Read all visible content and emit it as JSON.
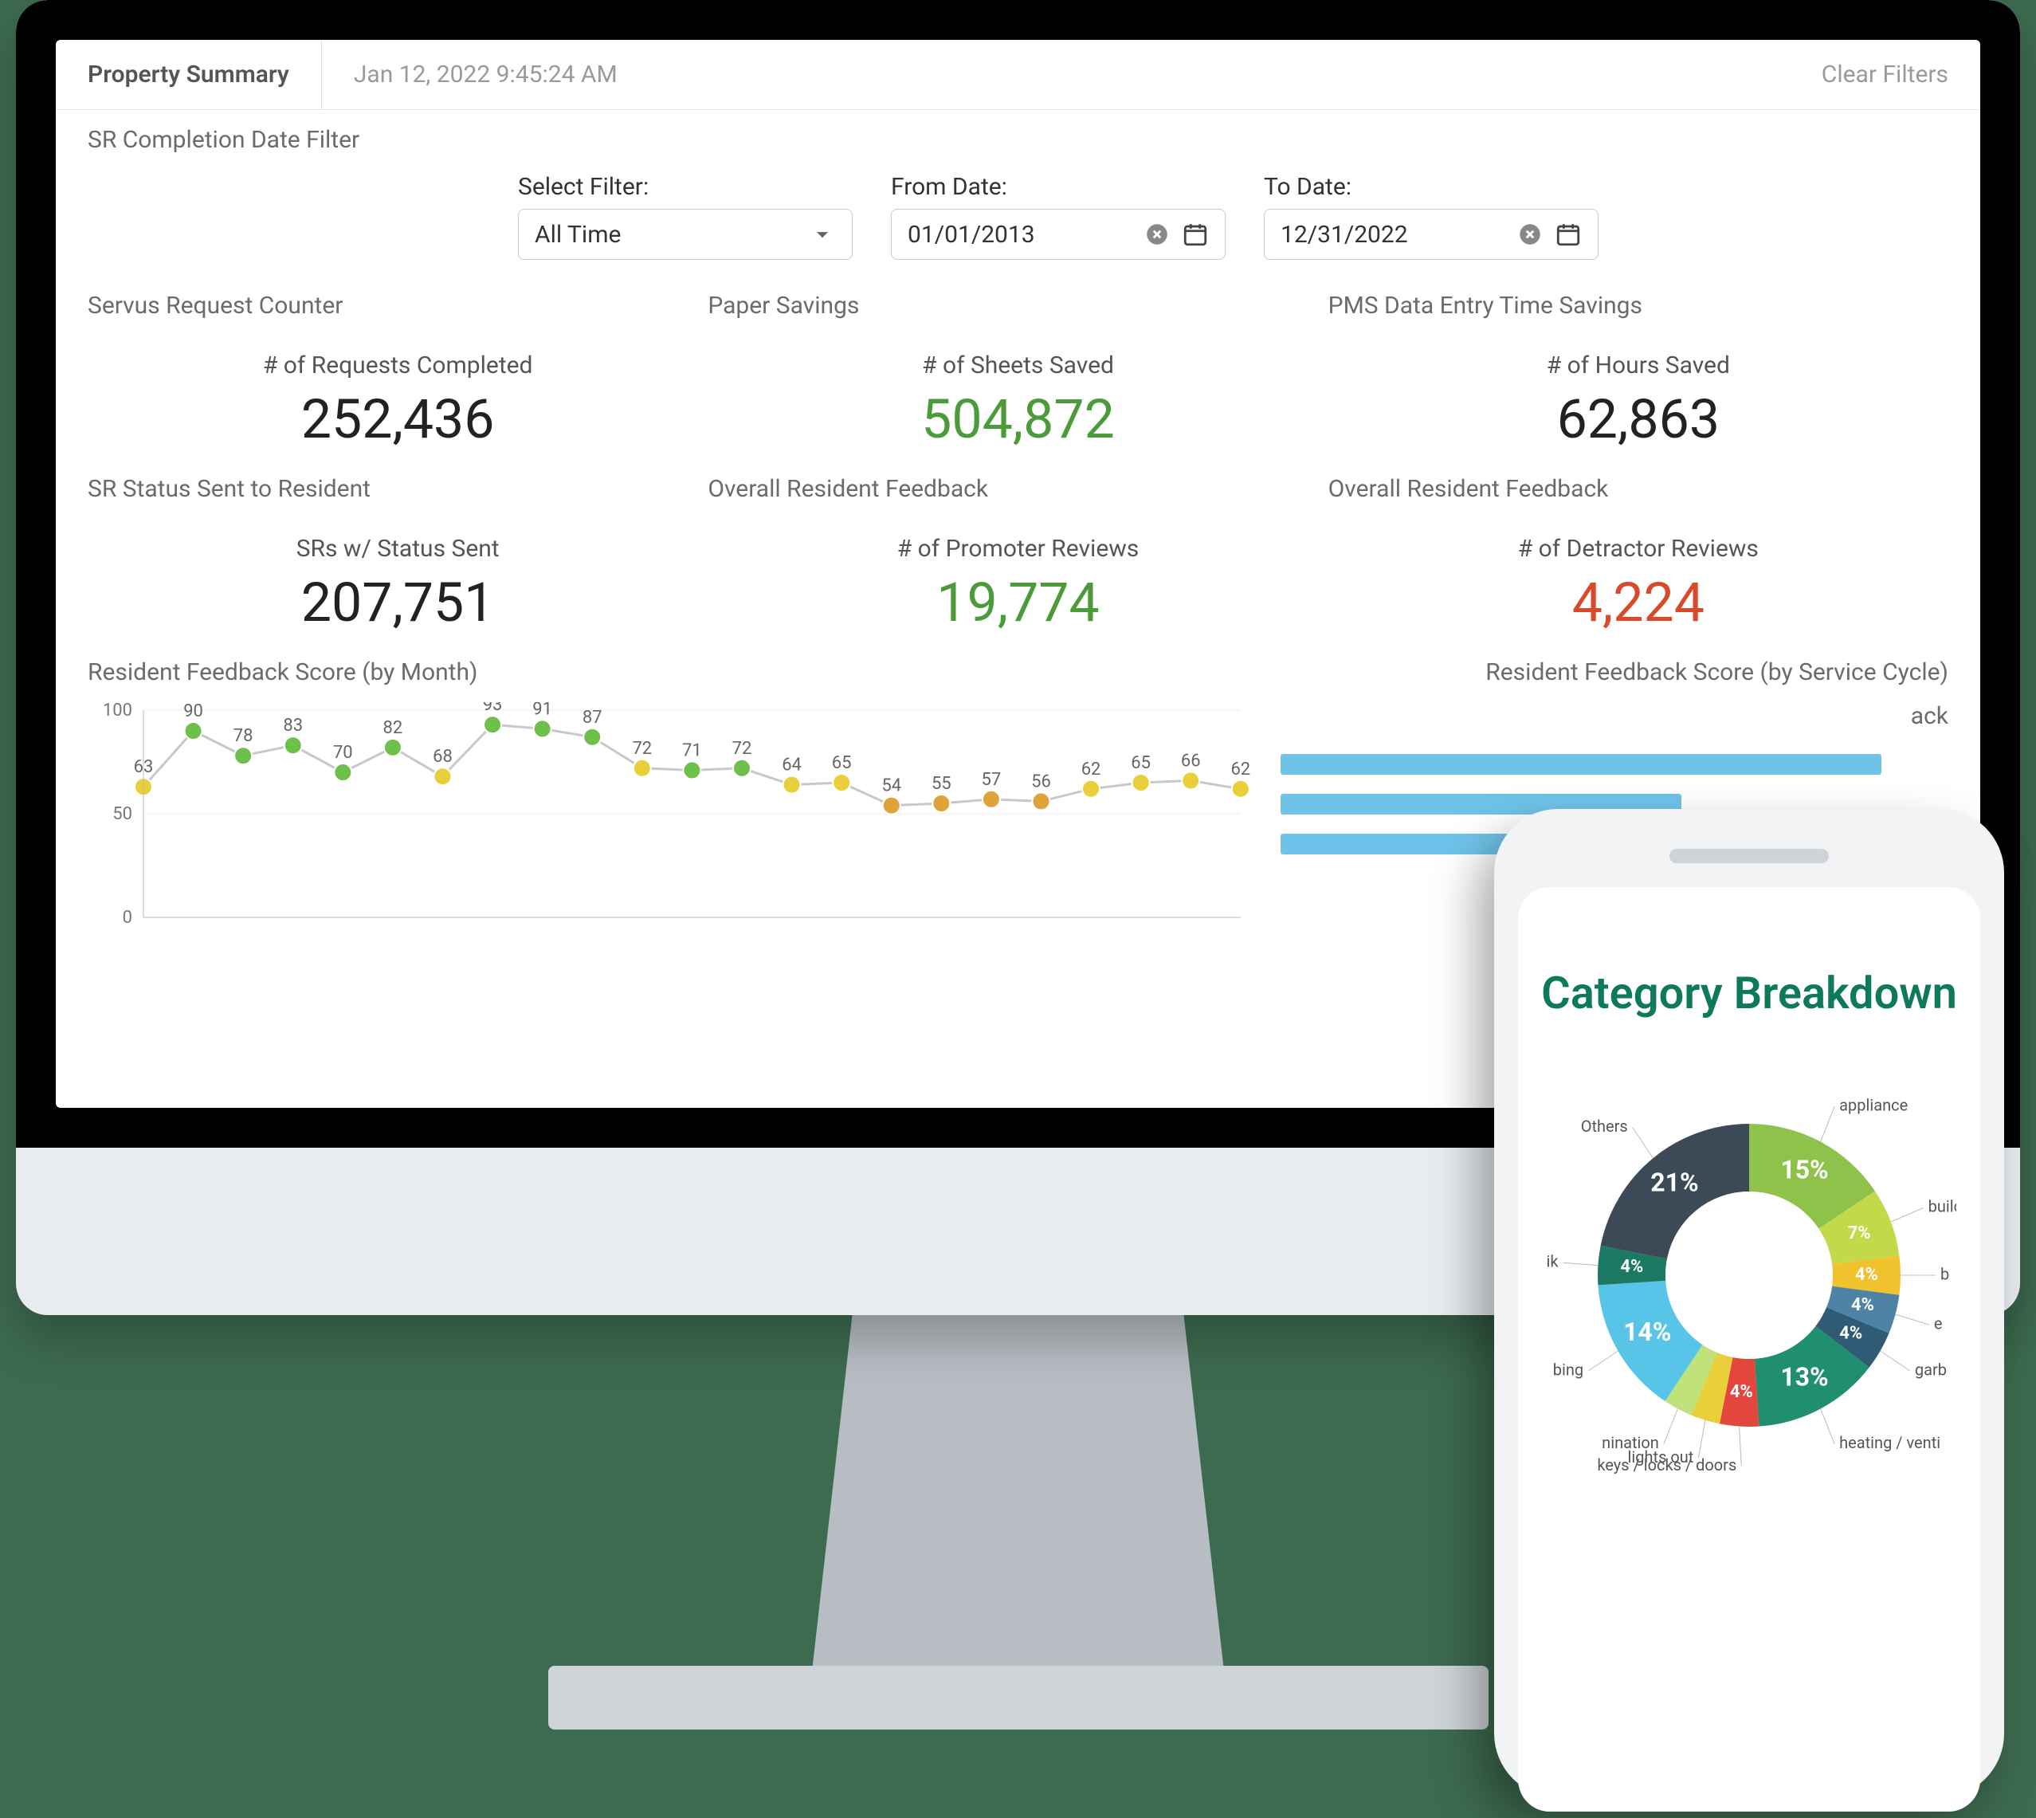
{
  "header": {
    "title": "Property Summary",
    "timestamp": "Jan 12, 2022 9:45:24 AM",
    "clear_filters": "Clear Filters"
  },
  "filter": {
    "section_label": "SR Completion Date Filter",
    "select_label": "Select Filter:",
    "select_value": "All Time",
    "from_label": "From Date:",
    "from_value": "01/01/2013",
    "to_label": "To Date:",
    "to_value": "12/31/2022"
  },
  "stats_top": {
    "col1": {
      "group": "Servus Request Counter",
      "sub": "# of Requests Completed",
      "value": "252,436"
    },
    "col2": {
      "group": "Paper Savings",
      "sub": "# of Sheets Saved",
      "value": "504,872"
    },
    "col3": {
      "group": "PMS Data Entry Time Savings",
      "sub": "# of Hours Saved",
      "value": "62,863"
    }
  },
  "stats_bottom": {
    "col1": {
      "group": "SR Status Sent to Resident",
      "sub": "SRs w/ Status Sent",
      "value": "207,751"
    },
    "col2": {
      "group": "Overall Resident Feedback",
      "sub": "# of Promoter Reviews",
      "value": "19,774"
    },
    "col3": {
      "group": "Overall Resident Feedback",
      "sub": "# of Detractor Reviews",
      "value": "4,224"
    }
  },
  "chart_left_title": "Resident Feedback Score (by Month)",
  "chart_right_title": "Resident Feedback Score (by Service Cycle)",
  "chart_right_partial": "ack",
  "phone": {
    "title": "Category Breakdown"
  },
  "chart_data": [
    {
      "type": "line",
      "title": "Resident Feedback Score (by Month)",
      "xlabel": "",
      "ylabel": "",
      "ylim": [
        0,
        100
      ],
      "y_ticks": [
        0,
        50,
        100
      ],
      "values": [
        63,
        90,
        78,
        83,
        70,
        82,
        68,
        93,
        91,
        87,
        72,
        71,
        72,
        64,
        65,
        54,
        55,
        57,
        56,
        62,
        65,
        66,
        62
      ],
      "point_colors": [
        "yellow",
        "green",
        "green",
        "green",
        "green",
        "green",
        "yellow",
        "green",
        "green",
        "green",
        "yellow",
        "green",
        "green",
        "yellow",
        "yellow",
        "orange",
        "orange",
        "orange",
        "orange",
        "yellow",
        "yellow",
        "yellow",
        "yellow"
      ]
    },
    {
      "type": "bar",
      "title": "Resident Feedback Score (by Service Cycle)",
      "categories": [],
      "values": [],
      "note": "Partially obscured by phone mockup; three light-blue bars visible."
    },
    {
      "type": "pie",
      "title": "Category Breakdown",
      "series": [
        {
          "name": "appliance",
          "value": 15
        },
        {
          "name": "build",
          "value": 7
        },
        {
          "name": "b",
          "value": 4
        },
        {
          "name": "e",
          "value": 4
        },
        {
          "name": "garb",
          "value": 4
        },
        {
          "name": "heating / venti",
          "value": 13
        },
        {
          "name": "keys / locks / doors",
          "value": 4
        },
        {
          "name": "lights out",
          "value": 3
        },
        {
          "name": "nination",
          "value": 3
        },
        {
          "name": "bing",
          "value": 14
        },
        {
          "name": "ik",
          "value": 4
        },
        {
          "name": "Others",
          "value": 21
        }
      ],
      "visible_percent_labels": [
        "21%",
        "15%",
        "7%",
        "13%",
        "14%",
        "4%"
      ]
    }
  ]
}
